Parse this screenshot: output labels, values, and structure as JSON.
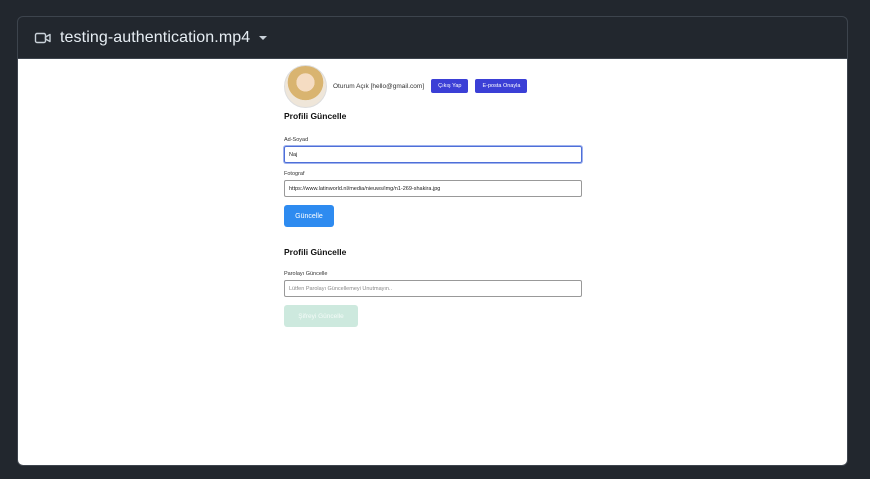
{
  "header": {
    "title": "testing-authentication.mp4"
  },
  "userbar": {
    "status": "Oturum Açık [hello@gmail.com]",
    "logout": "Çıkış Yap",
    "verify_email": "E-posta Onayla"
  },
  "profile": {
    "heading": "Profili Güncelle",
    "name_label": "Ad-Soyad",
    "name_value": "Naj",
    "photo_label": "Fotograf",
    "photo_value": "https://www.latinworld.nl/media/nieuws/img/n1-269-shakira.jpg",
    "submit": "Güncelle"
  },
  "password": {
    "heading": "Profili Güncelle",
    "label": "Parolayı Güncelle",
    "placeholder": "Lütfen Parolayı Güncellemeyi Unutmayın..",
    "submit": "Şifreyi Güncelle"
  }
}
